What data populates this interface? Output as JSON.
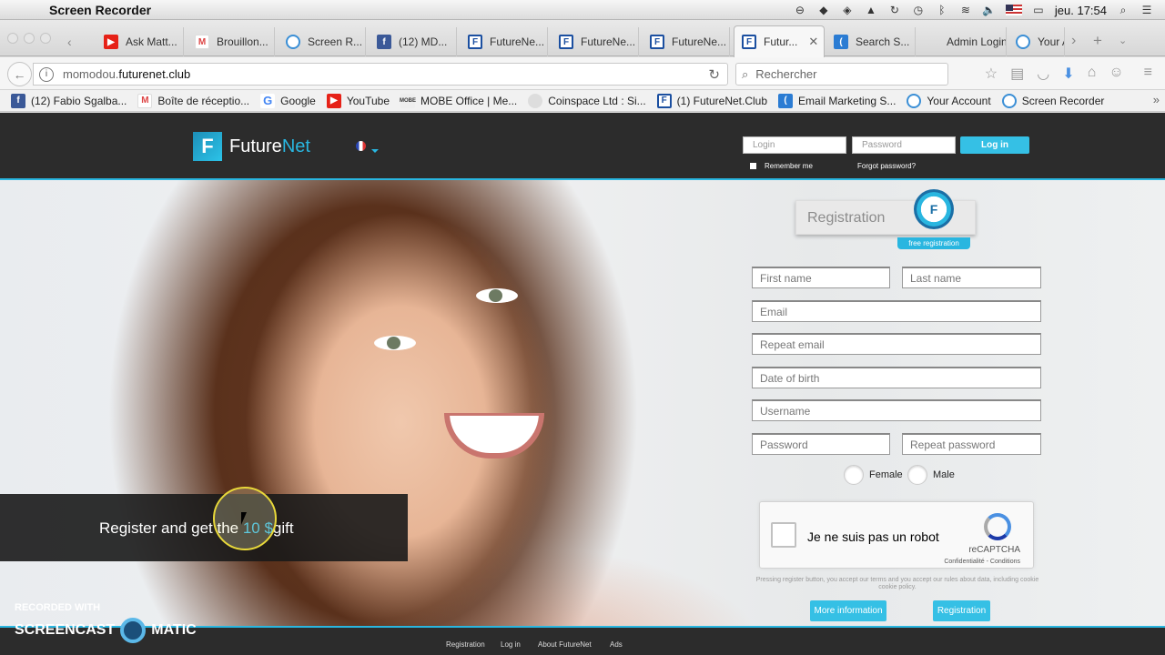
{
  "mac": {
    "app": "Screen Recorder",
    "time": "jeu. 17:54"
  },
  "tabs": [
    {
      "label": "Ask Matt...",
      "icon": "youtube"
    },
    {
      "label": "Brouillon...",
      "icon": "gmail"
    },
    {
      "label": "Screen R...",
      "icon": "screen-recorder"
    },
    {
      "label": "(12) MD...",
      "icon": "facebook"
    },
    {
      "label": "FutureNe...",
      "icon": "futurenet"
    },
    {
      "label": "FutureNe...",
      "icon": "futurenet"
    },
    {
      "label": "FutureNe...",
      "icon": "futurenet"
    },
    {
      "label": "Futur...",
      "icon": "futurenet",
      "active": true
    },
    {
      "label": "Search S...",
      "icon": "search-site"
    },
    {
      "label": "Admin Login",
      "icon": "none"
    },
    {
      "label": "Your A",
      "icon": "screen-recorder"
    }
  ],
  "url": {
    "prefix": "momodou.",
    "domain": "futurenet.club"
  },
  "search": {
    "placeholder": "Rechercher"
  },
  "bookmarks": [
    {
      "label": "(12) Fabio Sgalba...",
      "icon": "facebook"
    },
    {
      "label": "Boîte de réceptio...",
      "icon": "gmail"
    },
    {
      "label": "Google",
      "icon": "google"
    },
    {
      "label": "YouTube",
      "icon": "youtube"
    },
    {
      "label": "MOBE Office | Me...",
      "icon": "mobe"
    },
    {
      "label": "Coinspace Ltd : Si...",
      "icon": "coinspace"
    },
    {
      "label": "(1) FutureNet.Club",
      "icon": "futurenet"
    },
    {
      "label": "Email Marketing S...",
      "icon": "email-marketing"
    },
    {
      "label": "Your Account",
      "icon": "screen-recorder"
    },
    {
      "label": "Screen Recorder",
      "icon": "screen-recorder"
    }
  ],
  "site": {
    "brand_a": "Future",
    "brand_b": "Net",
    "login_placeholder": "Login",
    "password_placeholder": "Password",
    "login_btn": "Log in",
    "remember": "Remember me",
    "forgot": "Forgot password?",
    "reg_title": "Registration",
    "free_reg": "free registration",
    "fields": {
      "first": "First name",
      "last": "Last name",
      "email": "Email",
      "repeat_email": "Repeat email",
      "dob": "Date of birth",
      "username": "Username",
      "password": "Password",
      "repeat_password": "Repeat password"
    },
    "female": "Female",
    "male": "Male",
    "captcha_text": "Je ne suis pas un robot",
    "captcha_brand": "reCAPTCHA",
    "captcha_privacy": "Confidentialité - Conditions",
    "terms": "Pressing register button, you accept our terms and you accept our rules about data, including cookie cookie policy.",
    "more_info": "More information",
    "register_btn": "Registration",
    "banner_a": "Register and get the ",
    "banner_b": "10 $",
    "banner_c": "gift",
    "footer": [
      "Registration",
      "Log in",
      "About FutureNet",
      "Ads"
    ]
  },
  "watermark": {
    "line1": "RECORDED WITH",
    "line2a": "SCREENCAST",
    "line2b": "MATIC"
  }
}
